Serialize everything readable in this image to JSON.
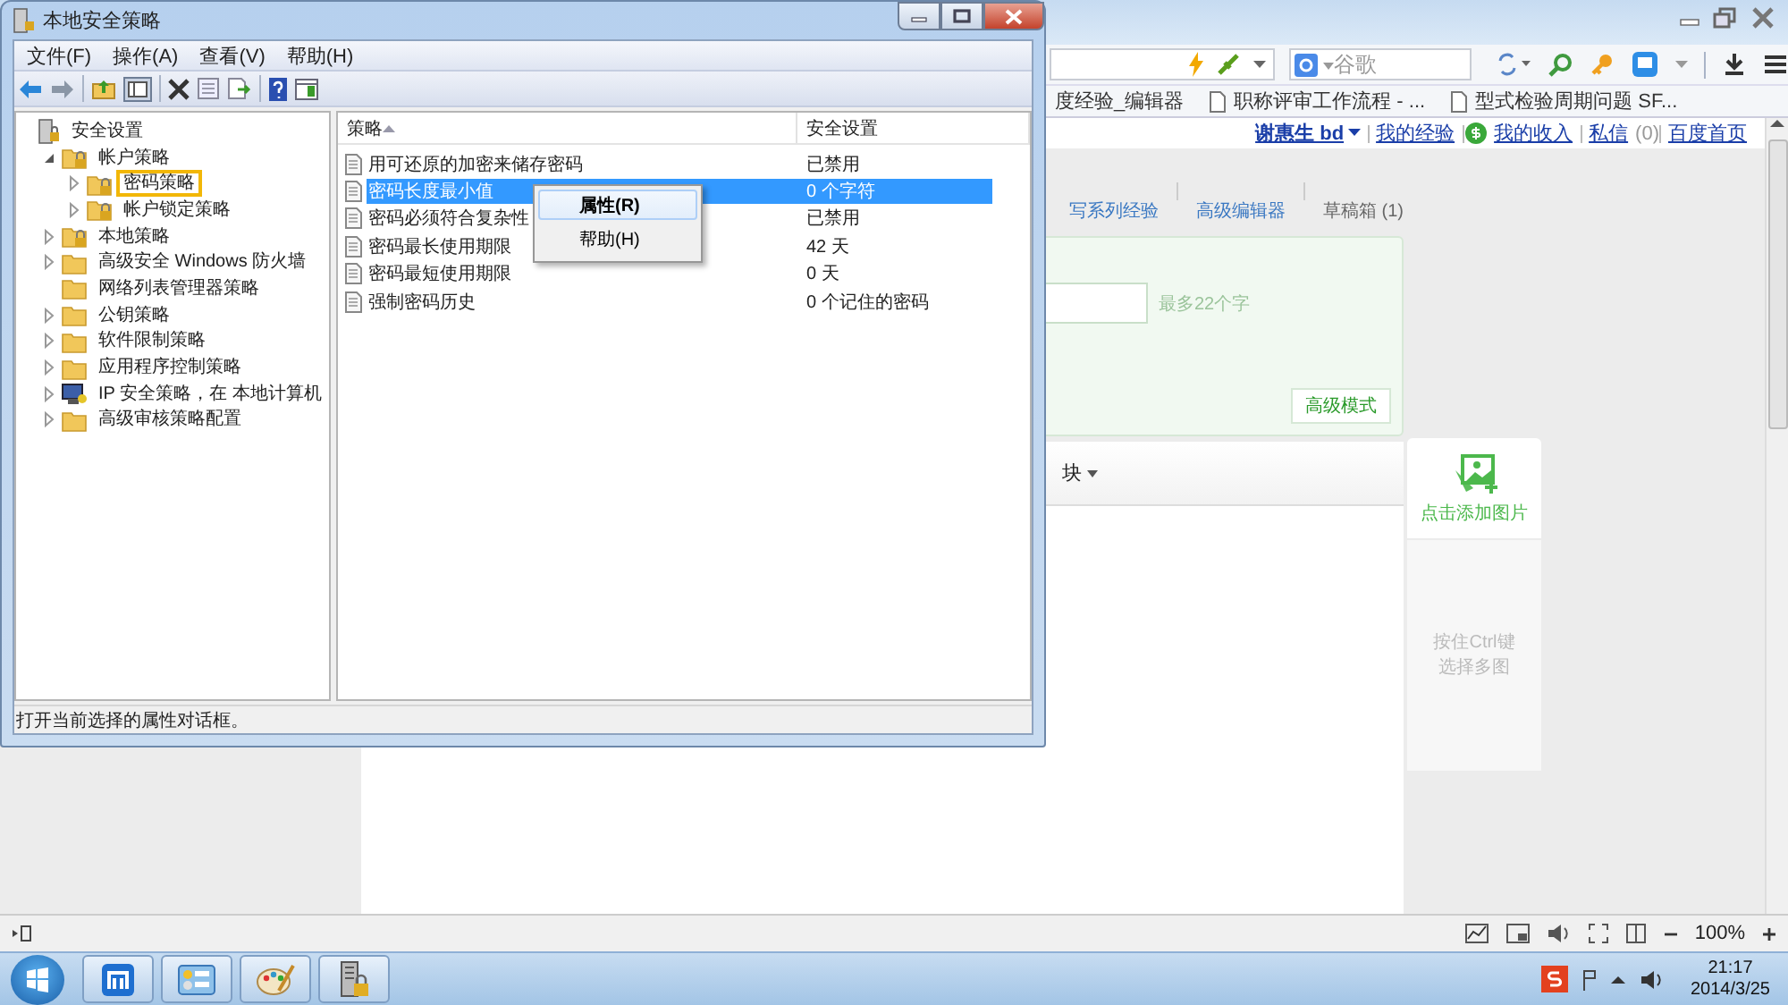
{
  "browser": {
    "search": {
      "placeholder": "谷歌"
    },
    "bookmarks": [
      {
        "label": "度经验_编辑器",
        "kind": "plain"
      },
      {
        "label": "职称评审工作流程 - ...",
        "kind": "page"
      },
      {
        "label": "型式检验周期问题 SF...",
        "kind": "page"
      }
    ],
    "user_links": [
      {
        "text": "谢惠生 bd",
        "kind": "user"
      },
      {
        "text": "我的经验",
        "kind": "link"
      },
      {
        "text": "我的收入",
        "kind": "income"
      },
      {
        "text": "私信",
        "kind": "messages",
        "count": "(0)"
      },
      {
        "text": "百度首页",
        "kind": "link"
      }
    ],
    "editor_tabs": [
      {
        "label": "写系列经验"
      },
      {
        "label": "高级编辑器"
      },
      {
        "label": "草稿箱 (1)"
      }
    ],
    "title_hint": "最多22个字",
    "advanced_button": "高级模式",
    "toolbar_item": "块",
    "image_upload": {
      "label": "点击添加图片",
      "hint": [
        "按住Ctrl键",
        "选择多图"
      ]
    },
    "zoom": "100%"
  },
  "mmc": {
    "title": "本地安全策略",
    "menu": [
      "文件(F)",
      "操作(A)",
      "查看(V)",
      "帮助(H)"
    ],
    "tree": [
      {
        "label": "安全设置",
        "kind": "settings",
        "expandable": false,
        "expanded": true,
        "highlighted": false,
        "children": [
          {
            "label": "帐户策略",
            "kind": "folder-lock",
            "expandable": true,
            "expanded": true,
            "highlighted": false,
            "children": [
              {
                "label": "密码策略",
                "kind": "folder-lock",
                "expandable": true,
                "expanded": false,
                "highlighted": true
              },
              {
                "label": "帐户锁定策略",
                "kind": "folder-lock",
                "expandable": true,
                "expanded": false,
                "highlighted": false
              }
            ]
          },
          {
            "label": "本地策略",
            "kind": "folder-lock",
            "expandable": true,
            "expanded": false,
            "highlighted": false
          },
          {
            "label": "高级安全 Windows 防火墙",
            "kind": "folder",
            "expandable": true,
            "expanded": false,
            "highlighted": false
          },
          {
            "label": "网络列表管理器策略",
            "kind": "folder",
            "expandable": false,
            "expanded": false,
            "highlighted": false
          },
          {
            "label": "公钥策略",
            "kind": "folder",
            "expandable": true,
            "expanded": false,
            "highlighted": false
          },
          {
            "label": "软件限制策略",
            "kind": "folder",
            "expandable": true,
            "expanded": false,
            "highlighted": false
          },
          {
            "label": "应用程序控制策略",
            "kind": "folder",
            "expandable": true,
            "expanded": false,
            "highlighted": false
          },
          {
            "label": "IP 安全策略，在 本地计算机",
            "kind": "ip",
            "expandable": true,
            "expanded": false,
            "highlighted": false
          },
          {
            "label": "高级审核策略配置",
            "kind": "folder",
            "expandable": true,
            "expanded": false,
            "highlighted": false
          }
        ]
      }
    ],
    "columns": [
      "策略",
      "安全设置"
    ],
    "rows": [
      {
        "policy": "用可还原的加密来储存密码",
        "setting": "已禁用",
        "selected": false
      },
      {
        "policy": "密码长度最小值",
        "setting": "0 个字符",
        "selected": true
      },
      {
        "policy": "密码必须符合复杂性",
        "setting": "已禁用",
        "selected": false
      },
      {
        "policy": "密码最长使用期限",
        "setting": "42 天",
        "selected": false
      },
      {
        "policy": "密码最短使用期限",
        "setting": "0 天",
        "selected": false
      },
      {
        "policy": "强制密码历史",
        "setting": "0 个记住的密码",
        "selected": false
      }
    ],
    "context_menu": [
      {
        "label": "属性(R)",
        "default": true,
        "selected": true
      },
      {
        "label": "帮助(H)",
        "default": false,
        "selected": false
      }
    ],
    "status": "打开当前选择的属性对话框。"
  },
  "taskbar": {
    "apps": [
      {
        "kind": "browser"
      },
      {
        "kind": "control-panel"
      },
      {
        "kind": "paint"
      },
      {
        "kind": "security"
      }
    ],
    "time": "21:17",
    "date": "2014/3/25"
  }
}
